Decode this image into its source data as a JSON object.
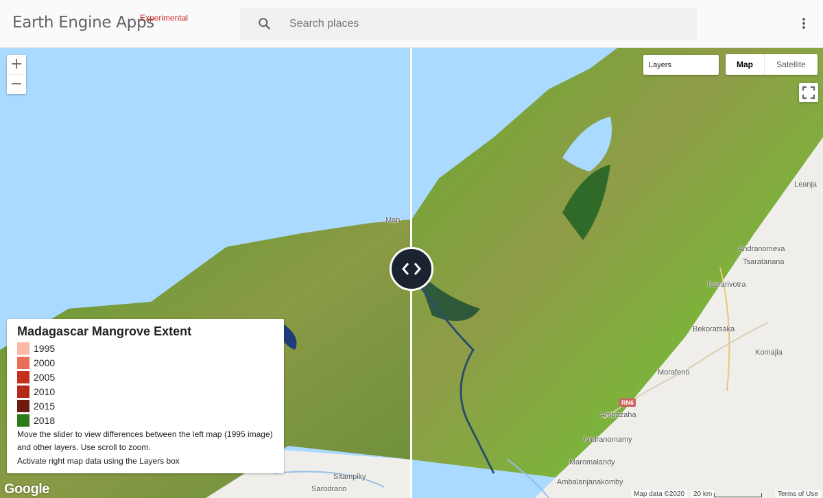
{
  "header": {
    "title": "Earth Engine Apps",
    "badge": "Experimental",
    "search_placeholder": "Search places",
    "menu_icon": "more-vert-icon",
    "search_icon": "search-icon"
  },
  "map_controls": {
    "zoom_in": "+",
    "zoom_out": "−",
    "layers_label": "Layers",
    "map_type_options": [
      "Map",
      "Satellite"
    ],
    "map_type_selected": "Map",
    "fullscreen_icon": "fullscreen-icon",
    "slider_icon": "split-slider-icon"
  },
  "legend": {
    "title": "Madagascar Mangrove Extent",
    "items": [
      {
        "label": "1995",
        "color": "#fcb8a6"
      },
      {
        "label": "2000",
        "color": "#e8705a"
      },
      {
        "label": "2005",
        "color": "#c5301e"
      },
      {
        "label": "2010",
        "color": "#b42a1a"
      },
      {
        "label": "2015",
        "color": "#6e1a10"
      },
      {
        "label": "2018",
        "color": "#2a7a1a"
      }
    ],
    "description_1": "Move the slider to view differences between the left map (1995 image) and other layers. Use scroll to zoom.",
    "description_2": "Activate right map data using the Layers box"
  },
  "map_labels": [
    {
      "text": "Mah"
    },
    {
      "text": "Leanja"
    },
    {
      "text": "Andranomeva"
    },
    {
      "text": "Tsaratanana"
    },
    {
      "text": "Tsararivotra"
    },
    {
      "text": "Bekoratsaka"
    },
    {
      "text": "Komajia"
    },
    {
      "text": "Morafeno"
    },
    {
      "text": "Ambazaha"
    },
    {
      "text": "Andranomamy"
    },
    {
      "text": "Maromalandy"
    },
    {
      "text": "Ambalanjanakomby"
    },
    {
      "text": "Sitampiky"
    },
    {
      "text": "Sarodrano"
    }
  ],
  "road_label": "RN6",
  "attribution": {
    "logo": "Google",
    "map_data": "Map data ©2020",
    "scale": "20 km",
    "terms": "Terms of Use"
  },
  "colors": {
    "water": "#aadaff",
    "land": "#efeeea",
    "accent_badge": "#c5221f"
  }
}
